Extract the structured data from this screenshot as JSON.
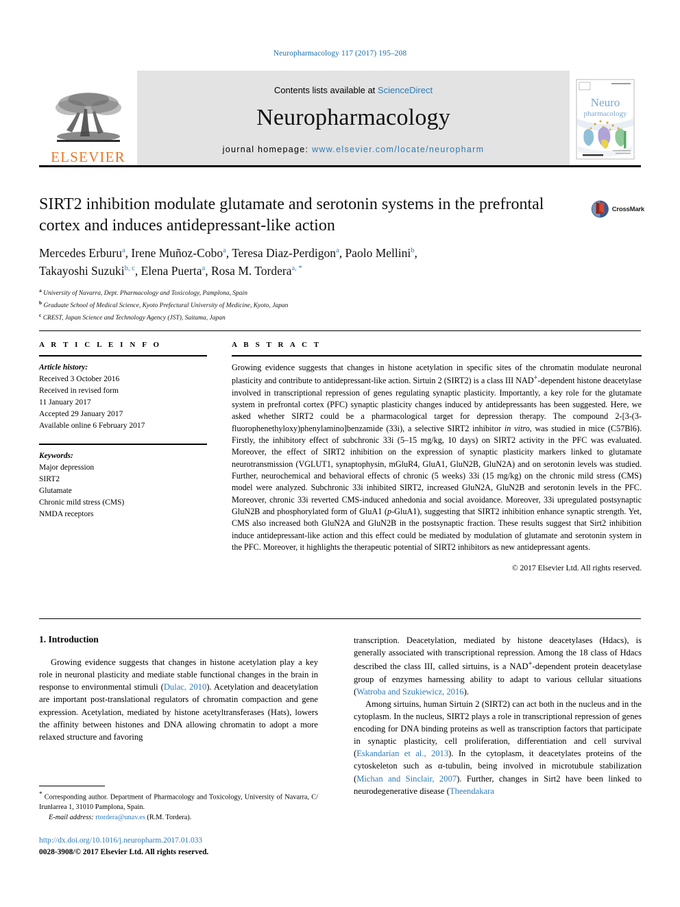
{
  "running_head": "Neuropharmacology 117 (2017) 195–208",
  "masthead": {
    "publisher_logo_name": "ELSEVIER",
    "contents_prefix": "Contents lists available at ",
    "contents_link": "ScienceDirect",
    "journal_name": "Neuropharmacology",
    "homepage_prefix": "journal homepage: ",
    "homepage_url": "www.elsevier.com/locate/neuropharm",
    "cover_title_line1": "Neuro",
    "cover_title_line2": "pharmacology"
  },
  "article": {
    "title": "SIRT2 inhibition modulate glutamate and serotonin systems in the prefrontal cortex and induces antidepressant-like action",
    "crossmark_label": "CrossMark",
    "authors_line1_parts": [
      {
        "name": "Mercedes Erburu",
        "mark": "a"
      },
      {
        "name": "Irene Muñoz-Cobo",
        "mark": "a"
      },
      {
        "name": "Teresa Diaz-Perdigon",
        "mark": "a"
      },
      {
        "name": "Paolo Mellini",
        "mark": "b"
      }
    ],
    "authors_line2_parts": [
      {
        "name": "Takayoshi Suzuki",
        "mark": "b, c"
      },
      {
        "name": "Elena Puerta",
        "mark": "a"
      },
      {
        "name": "Rosa M. Tordera",
        "mark": "a, *"
      }
    ],
    "affiliations": [
      {
        "mark": "a",
        "text": "University of Navarra, Dept. Pharmacology and Toxicology, Pamplona, Spain"
      },
      {
        "mark": "b",
        "text": "Graduate School of Medical Science, Kyoto Prefectural University of Medicine, Kyoto, Japan"
      },
      {
        "mark": "c",
        "text": "CREST, Japan Science and Technology Agency (JST), Saitama, Japan"
      }
    ]
  },
  "article_info": {
    "heading": "A R T I C L E   I N F O",
    "history_label": "Article history:",
    "history_lines": [
      "Received 3 October 2016",
      "Received in revised form",
      "11 January 2017",
      "Accepted 29 January 2017",
      "Available online 6 February 2017"
    ],
    "keywords_label": "Keywords:",
    "keywords": [
      "Major depression",
      "SIRT2",
      "Glutamate",
      "Chronic mild stress (CMS)",
      "NMDA receptors"
    ]
  },
  "abstract": {
    "heading": "A B S T R A C T",
    "text_part1": "Growing evidence suggests that changes in histone acetylation in specific sites of the chromatin modulate neuronal plasticity and contribute to antidepressant-like action. Sirtuin 2 (SIRT2) is a class III NAD",
    "nad_sup": "+",
    "text_part2": "-dependent histone deacetylase involved in transcriptional repression of genes regulating synaptic plasticity. Importantly, a key role for the glutamate system in prefrontal cortex (PFC) synaptic plasticity changes induced by antidepressants has been suggested. Here, we asked whether SIRT2 could be a pharmacological target for depression therapy. The compound 2-[3-(3-fluorophenethyloxy)phenylamino]benzamide (33i), a selective SIRT2 inhibitor ",
    "in_vitro": "in vitro",
    "text_part3": ", was studied in mice (C57Bl6). Firstly, the inhibitory effect of subchronic 33i (5–15 mg/kg, 10 days) on SIRT2 activity in the PFC was evaluated. Moreover, the effect of SIRT2 inhibition on the expression of synaptic plasticity markers linked to glutamate neurotransmission (VGLUT1, synaptophysin, mGluR4, GluA1, GluN2B, GluN2A) and on serotonin levels was studied. Further, neurochemical and behavioral effects of chronic (5 weeks) 33i (15 mg/kg) on the chronic mild stress (CMS) model were analyzed. Subchronic 33i inhibited SIRT2, increased GluN2A, GluN2B and serotonin levels in the PFC. Moreover, chronic 33i reverted CMS-induced anhedonia and social avoidance. Moreover, 33i upregulated postsynaptic GluN2B and phosphorylated form of GluA1 (",
    "p_glua1_italic": "p",
    "text_part4": "-GluA1), suggesting that SIRT2 inhibition enhance synaptic strength. Yet, CMS also increased both GluN2A and GluN2B in the postsynaptic fraction. These results suggest that Sirt2 inhibition induce antidepressant-like action and this effect could be mediated by modulation of glutamate and serotonin system in the PFC. Moreover, it highlights the therapeutic potential of SIRT2 inhibitors as new antidepressant agents.",
    "copyright": "© 2017 Elsevier Ltd. All rights reserved."
  },
  "body": {
    "section_title": "1. Introduction",
    "left_para1_a": "Growing evidence suggests that changes in histone acetylation play a key role in neuronal plasticity and mediate stable functional changes in the brain in response to environmental stimuli (",
    "left_para1_ref1": "Dulac, 2010",
    "left_para1_b": "). Acetylation and deacetylation are important post-translational regulators of chromatin compaction and gene expression. Acetylation, mediated by histone acetyltransferases (Hats), lowers the affinity between histones and DNA allowing chromatin to adopt a more relaxed structure and favoring",
    "right_para1_a": "transcription. Deacetylation, mediated by histone deacetylases (Hdacs), is generally associated with transcriptional repression. Among the 18 class of Hdacs described the class III, called sirtuins, is a NAD",
    "right_para1_sup": "+",
    "right_para1_b": "-dependent protein deacetylase group of enzymes harnessing ability to adapt to various cellular situations (",
    "right_para1_ref1": "Watroba and Szukiewicz, 2016",
    "right_para1_c": ").",
    "right_para2_a": "Among sirtuins, human Sirtuin 2 (SIRT2) can act both in the nucleus and in the cytoplasm. In the nucleus, SIRT2 plays a role in transcriptional repression of genes encoding for DNA binding proteins as well as transcription factors that participate in synaptic plasticity, cell proliferation, differentiation and cell survival (",
    "right_para2_ref1": "Eskandarian et al., 2013",
    "right_para2_b": "). In the cytoplasm, it deacetylates proteins of the cytoskeleton such as α-tubulin, being involved in microtubule stabilization (",
    "right_para2_ref2": "Michan and Sinclair, 2007",
    "right_para2_c": "). Further, changes in Sirt2 have been linked to neurodegenerative disease (",
    "right_para2_ref3": "Theendakara"
  },
  "footer": {
    "corresponding_star": "*",
    "corresponding_text": " Corresponding author. Department of Pharmacology and Toxicology, University of Navarra, C/ Irunlarrea 1, 31010 Pamplona, Spain.",
    "email_label": "E-mail address:",
    "email": "rtordera@unav.es",
    "email_owner": "(R.M. Tordera).",
    "doi": "http://dx.doi.org/10.1016/j.neuropharm.2017.01.033",
    "issn_line": "0028-3908/© 2017 Elsevier Ltd. All rights reserved."
  },
  "colors": {
    "link": "#2e7bb5",
    "running_head": "#1a6ea8",
    "elsevier_orange": "#e87722",
    "masthead_bg": "#e3e3e3"
  }
}
